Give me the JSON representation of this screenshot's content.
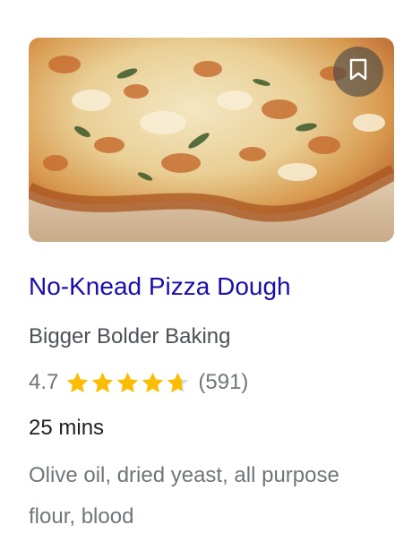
{
  "recipe": {
    "image_alt": "pizza",
    "title": "No-Knead Pizza Dough",
    "source": "Bigger Bolder Baking",
    "rating": "4.7",
    "rating_stars": 4.7,
    "rating_max": 5,
    "review_count": "(591)",
    "cook_time": "25 mins",
    "ingredients": "Olive oil, dried yeast, all purpose flour, blood"
  },
  "bookmark": {
    "icon": "bookmark-icon"
  },
  "colors": {
    "title_link": "#1a0dab",
    "star_filled": "#fbbc04",
    "star_empty": "#dadce0",
    "secondary_text": "#70757a",
    "source_text": "#4d5156"
  }
}
